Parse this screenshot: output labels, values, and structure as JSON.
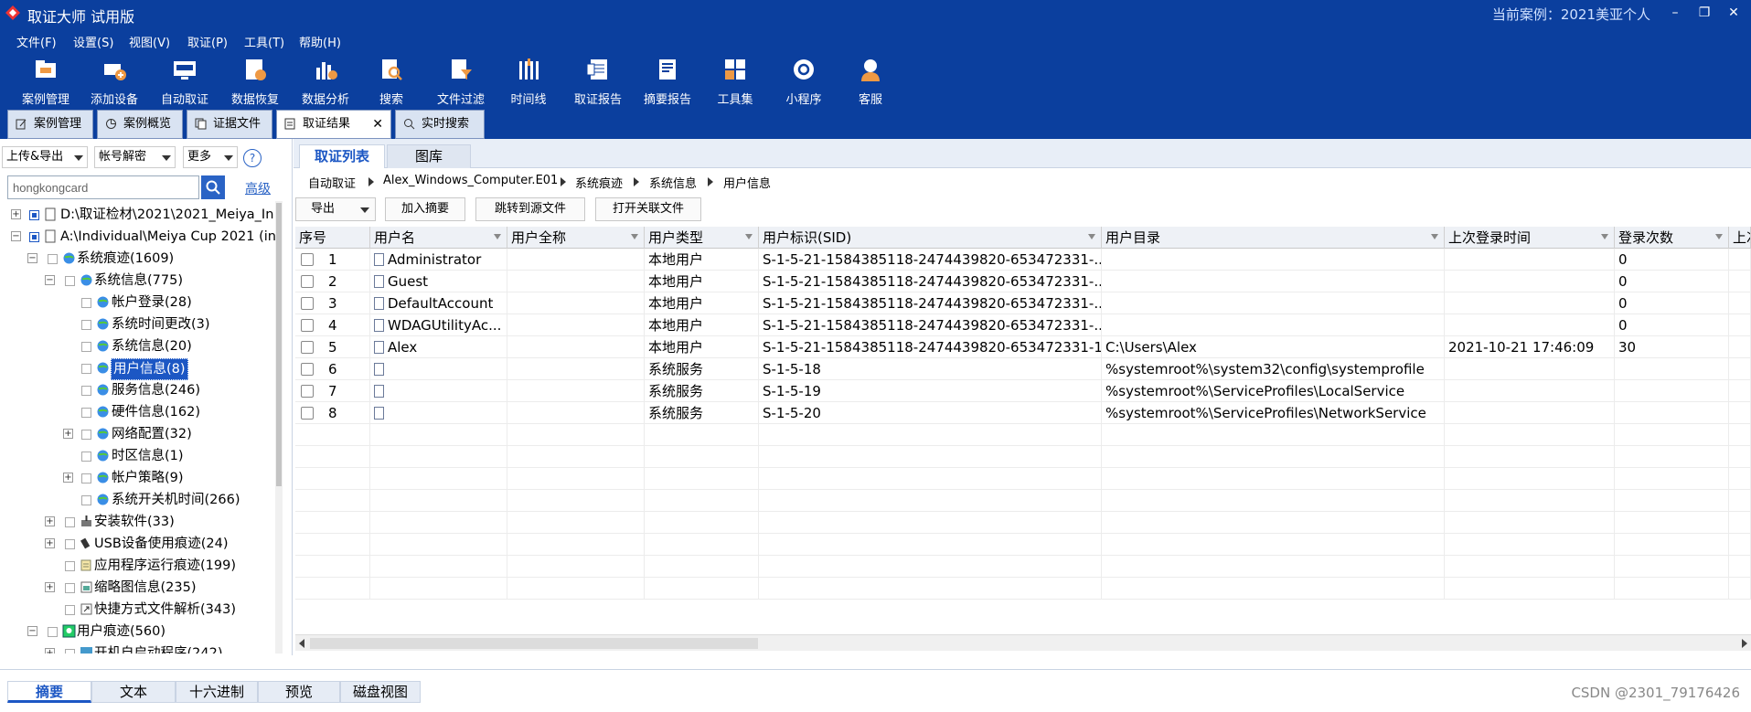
{
  "app": {
    "title": "取证大师 试用版",
    "current_case": "当前案例：2021美亚个人"
  },
  "menu": [
    "文件(F)",
    "设置(S)",
    "视图(V)",
    "取证(P)",
    "工具(T)",
    "帮助(H)"
  ],
  "toolbar": [
    {
      "label": "案例管理",
      "icon": "case-folder-icon"
    },
    {
      "label": "添加设备",
      "icon": "add-device-icon"
    },
    {
      "label": "自动取证",
      "icon": "auto-forensics-icon"
    },
    {
      "label": "数据恢复",
      "icon": "data-recovery-icon"
    },
    {
      "label": "数据分析",
      "icon": "data-analysis-icon"
    },
    {
      "label": "搜索",
      "icon": "search-document-icon"
    },
    {
      "label": "文件过滤",
      "icon": "file-filter-icon"
    },
    {
      "label": "时间线",
      "icon": "timeline-icon"
    },
    {
      "label": "取证报告",
      "icon": "forensic-report-icon"
    },
    {
      "label": "摘要报告",
      "icon": "summary-report-icon"
    },
    {
      "label": "工具集",
      "icon": "toolset-icon"
    },
    {
      "label": "小程序",
      "icon": "mini-program-icon"
    },
    {
      "label": "客服",
      "icon": "customer-service-icon"
    }
  ],
  "doc_tabs": [
    {
      "label": "案例管理"
    },
    {
      "label": "案例概览"
    },
    {
      "label": "证据文件"
    },
    {
      "label": "取证结果",
      "active": true
    },
    {
      "label": "实时搜索"
    }
  ],
  "left": {
    "upload_export": "上传&导出",
    "account_decrypt": "帐号解密",
    "more": "更多",
    "help": "?",
    "search_value": "hongkongcard",
    "advanced": "高级",
    "tree": [
      {
        "label": "D:\\取证检材\\2021\\2021_Meiya_In",
        "level": 0,
        "expander": "+",
        "checked": true
      },
      {
        "label": "A:\\Individual\\Meiya Cup 2021 (in",
        "level": 0,
        "expander": "-",
        "checked": true
      },
      {
        "label": "系统痕迹(1609)",
        "level": 1,
        "expander": "-"
      },
      {
        "label": "系统信息(775)",
        "level": 2,
        "expander": "-"
      },
      {
        "label": "帐户登录(28)",
        "level": 3
      },
      {
        "label": "系统时间更改(3)",
        "level": 3
      },
      {
        "label": "系统信息(20)",
        "level": 3
      },
      {
        "label": "用户信息(8)",
        "level": 3,
        "selected": true
      },
      {
        "label": "服务信息(246)",
        "level": 3
      },
      {
        "label": "硬件信息(162)",
        "level": 3
      },
      {
        "label": "网络配置(32)",
        "level": 3,
        "expander": "+"
      },
      {
        "label": "时区信息(1)",
        "level": 3
      },
      {
        "label": "帐户策略(9)",
        "level": 3,
        "expander": "+"
      },
      {
        "label": "系统开关机时间(266)",
        "level": 3
      },
      {
        "label": "安装软件(33)",
        "level": 2,
        "expander": "+"
      },
      {
        "label": "USB设备使用痕迹(24)",
        "level": 2,
        "expander": "+"
      },
      {
        "label": "应用程序运行痕迹(199)",
        "level": 2
      },
      {
        "label": "缩略图信息(235)",
        "level": 2,
        "expander": "+"
      },
      {
        "label": "快捷方式文件解析(343)",
        "level": 2
      },
      {
        "label": "用户痕迹(560)",
        "level": 1,
        "expander": "-"
      },
      {
        "label": "开机自启动程序(242)",
        "level": 2,
        "expander": "+"
      }
    ]
  },
  "right": {
    "subtabs": [
      "取证列表",
      "图库"
    ],
    "breadcrumb": [
      "自动取证",
      "Alex_Windows_Computer.E01",
      "系统痕迹",
      "系统信息",
      "用户信息"
    ],
    "actions": {
      "export": "导出",
      "add_summary": "加入摘要",
      "jump_source": "跳转到源文件",
      "open_related": "打开关联文件"
    },
    "columns": [
      "序号",
      "用户名",
      "用户全称",
      "用户类型",
      "用户标识(SID)",
      "用户目录",
      "上次登录时间",
      "登录次数",
      "上次"
    ],
    "rows": [
      {
        "no": "1",
        "name": "Administrator",
        "full": "",
        "type": "本地用户",
        "sid": "S-1-5-21-1584385118-2474439820-653472331-...",
        "dir": "",
        "last": "",
        "count": "0"
      },
      {
        "no": "2",
        "name": "Guest",
        "full": "",
        "type": "本地用户",
        "sid": "S-1-5-21-1584385118-2474439820-653472331-...",
        "dir": "",
        "last": "",
        "count": "0"
      },
      {
        "no": "3",
        "name": "DefaultAccount",
        "full": "",
        "type": "本地用户",
        "sid": "S-1-5-21-1584385118-2474439820-653472331-...",
        "dir": "",
        "last": "",
        "count": "0"
      },
      {
        "no": "4",
        "name": "WDAGUtilityAc...",
        "full": "",
        "type": "本地用户",
        "sid": "S-1-5-21-1584385118-2474439820-653472331-...",
        "dir": "",
        "last": "",
        "count": "0"
      },
      {
        "no": "5",
        "name": "Alex",
        "full": "",
        "type": "本地用户",
        "sid": "S-1-5-21-1584385118-2474439820-653472331-1...",
        "dir": "C:\\Users\\Alex",
        "last": "2021-10-21 17:46:09",
        "count": "30"
      },
      {
        "no": "6",
        "name": "",
        "full": "",
        "type": "系统服务",
        "sid": "S-1-5-18",
        "dir": "%systemroot%\\system32\\config\\systemprofile",
        "last": "",
        "count": ""
      },
      {
        "no": "7",
        "name": "",
        "full": "",
        "type": "系统服务",
        "sid": "S-1-5-19",
        "dir": "%systemroot%\\ServiceProfiles\\LocalService",
        "last": "",
        "count": ""
      },
      {
        "no": "8",
        "name": "",
        "full": "",
        "type": "系统服务",
        "sid": "S-1-5-20",
        "dir": "%systemroot%\\ServiceProfiles\\NetworkService",
        "last": "",
        "count": ""
      }
    ]
  },
  "bottom_tabs": [
    "摘要",
    "文本",
    "十六进制",
    "预览",
    "磁盘视图"
  ],
  "watermark": "CSDN @2301_79176426",
  "colors": {
    "brand": "#0b3f9e",
    "accent": "#1c57c4"
  }
}
